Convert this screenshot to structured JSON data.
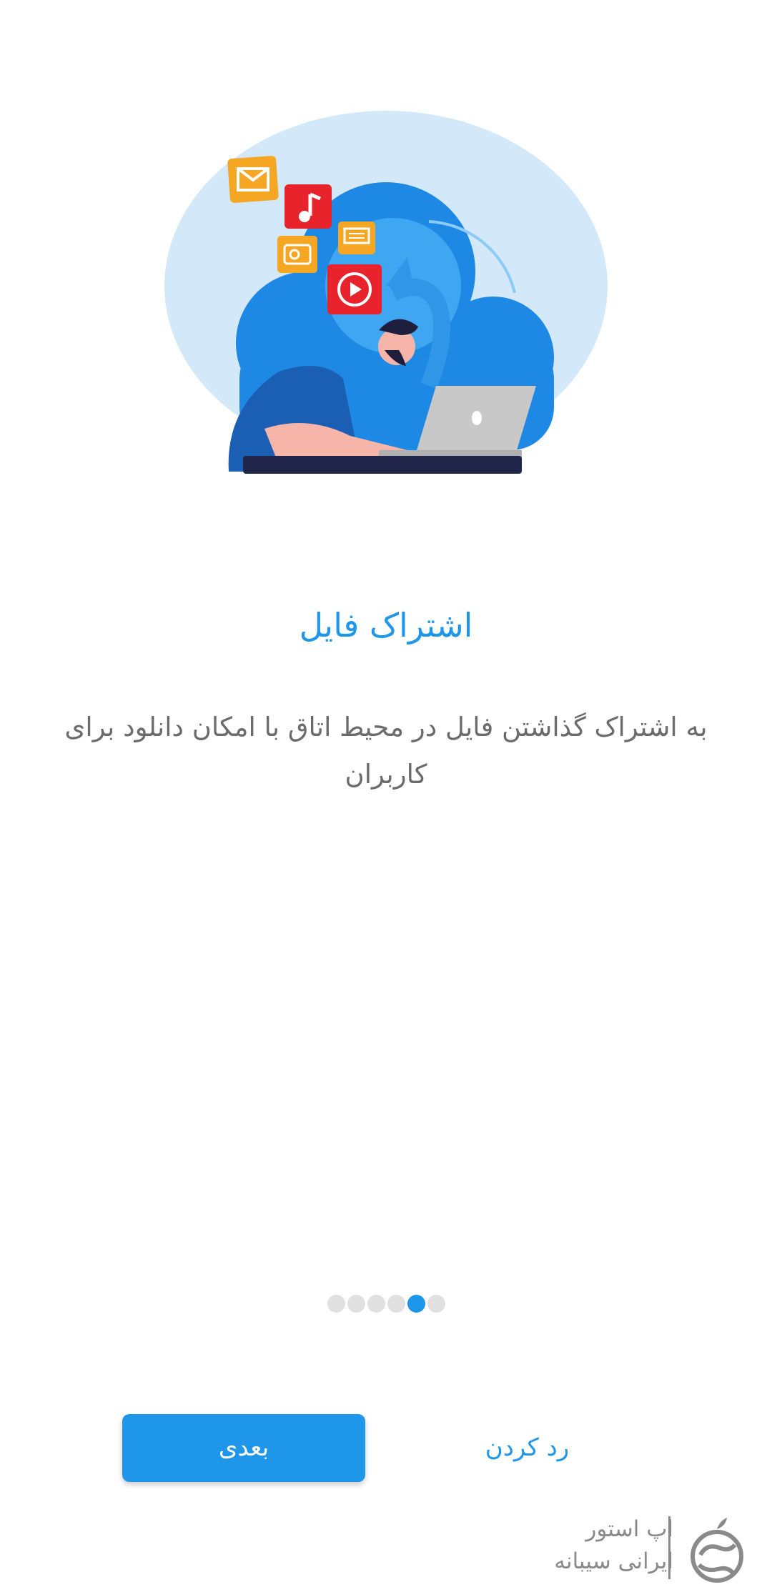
{
  "onboarding": {
    "title": "اشتراک فایل",
    "description": "به اشتراک گذاشتن فایل در محیط اتاق با امکان دانلود برای کاربران",
    "total_pages": 6,
    "current_page": 5
  },
  "actions": {
    "next_label": "بعدی",
    "reject_label": "رد کردن"
  },
  "watermark": {
    "line1": "اپ استور",
    "line2": "ایرانی سیبانه"
  },
  "colors": {
    "accent": "#1E96E9",
    "text_gray": "#6b6b6b",
    "dot_inactive": "#e0e0e0"
  },
  "icons": [
    "mail-icon",
    "music-icon",
    "camera-icon",
    "chat-icon",
    "play-icon",
    "person-icon",
    "laptop-icon",
    "cloud-icon",
    "sibaneh-logo-icon"
  ]
}
